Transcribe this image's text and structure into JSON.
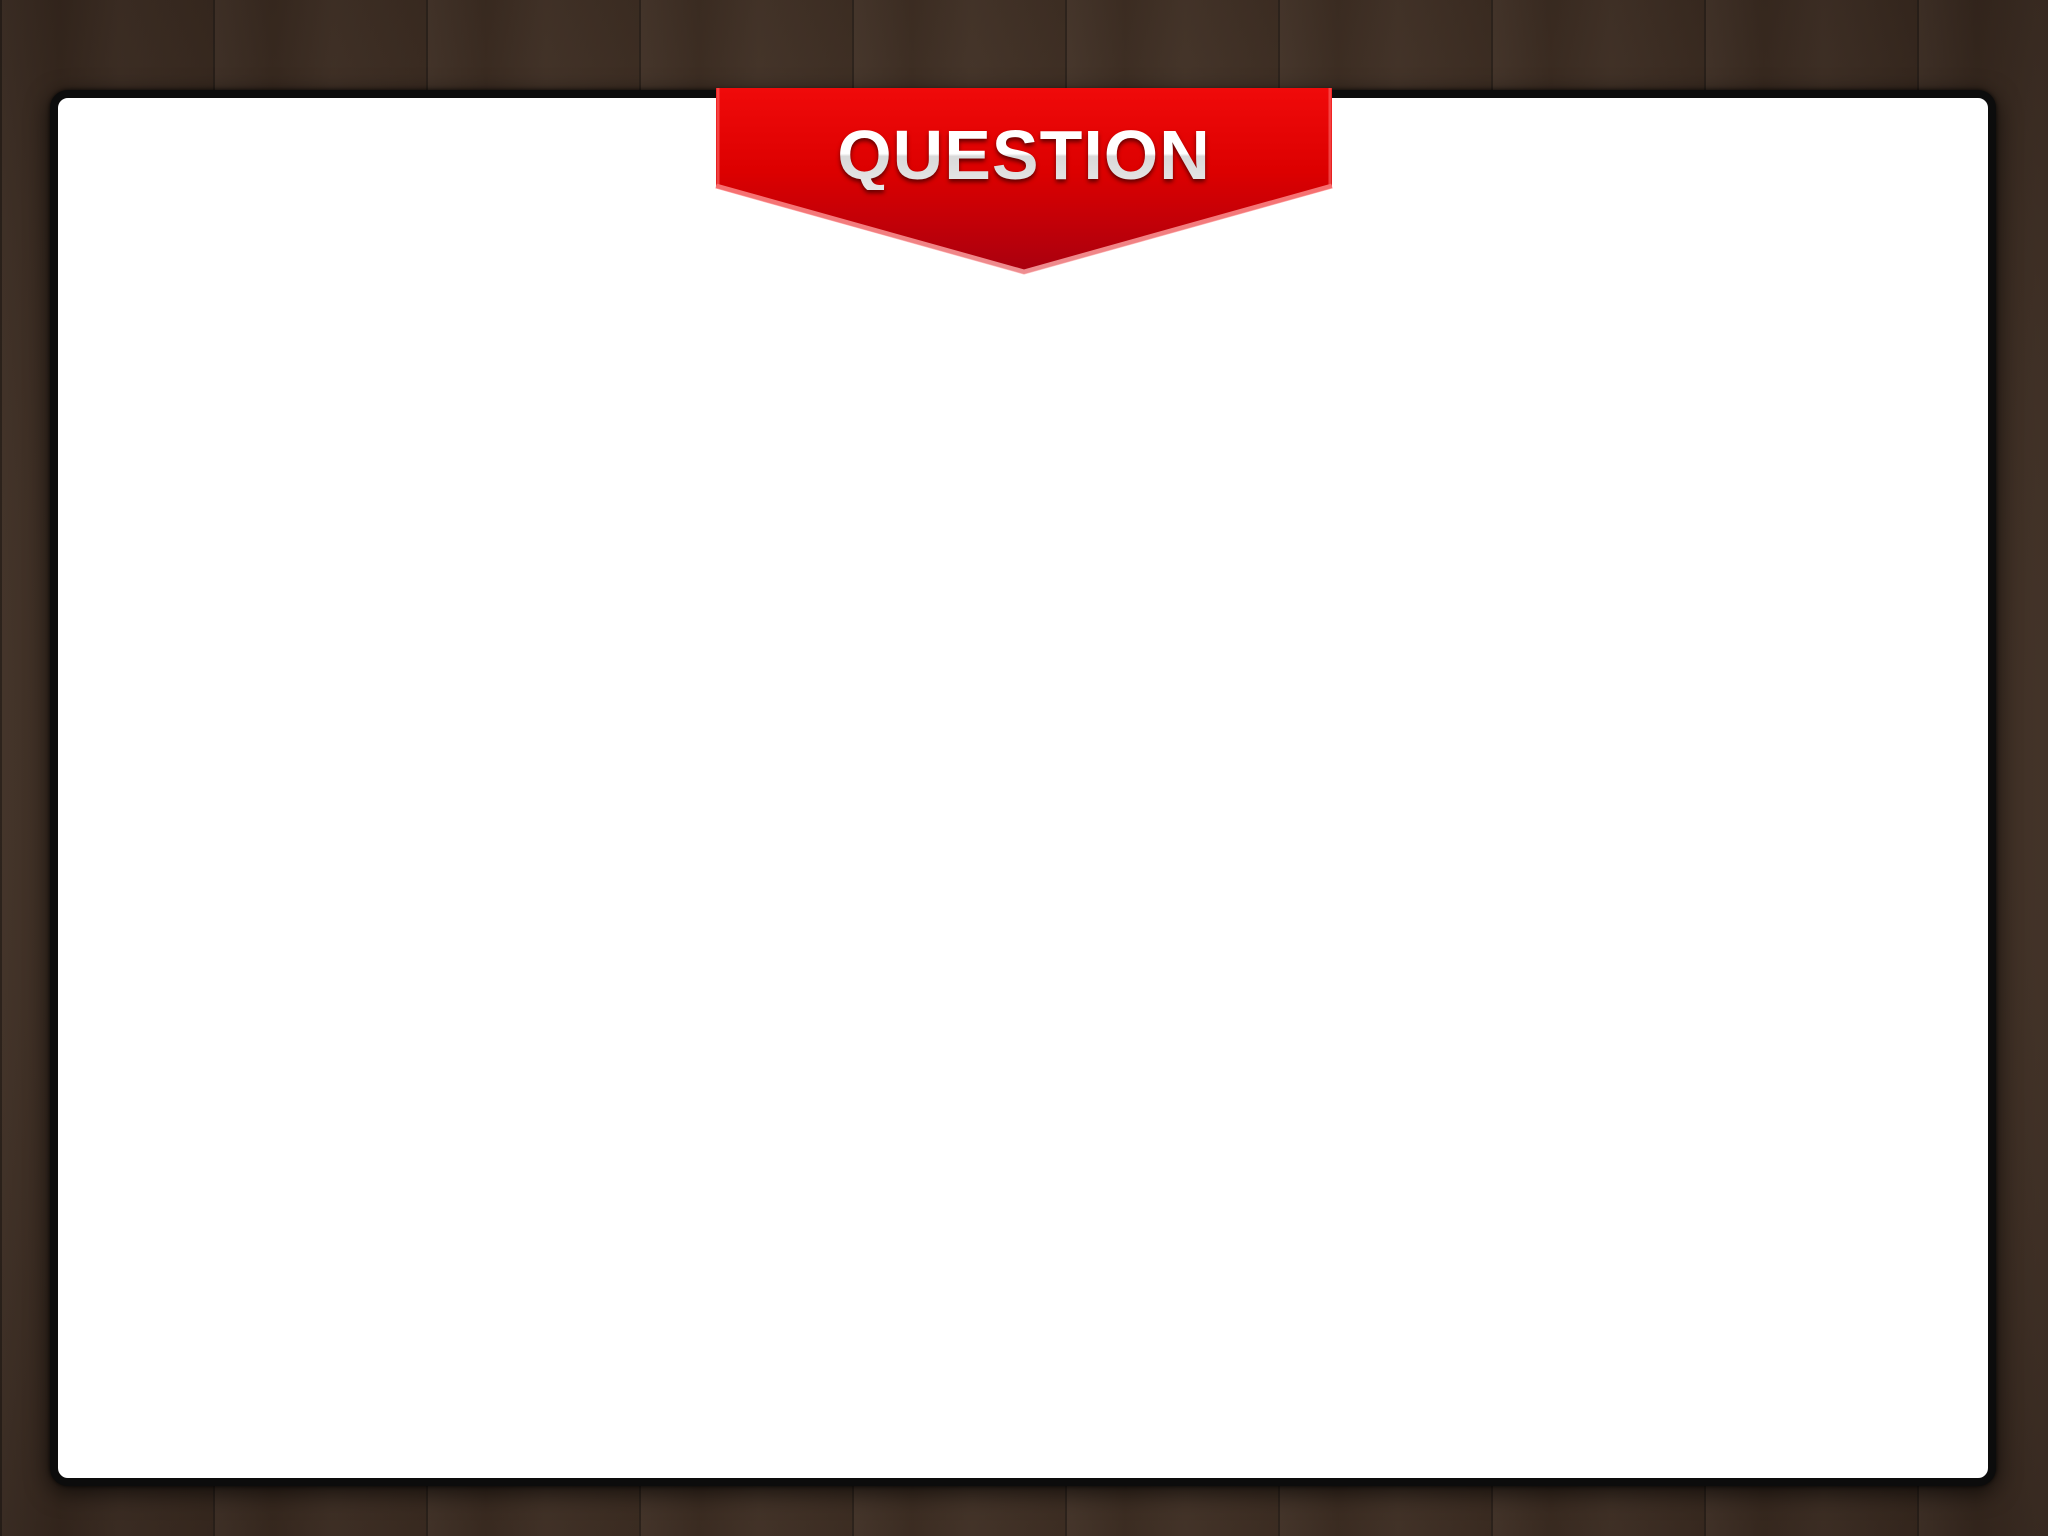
{
  "ribbon": {
    "label": "QUESTION",
    "color": "#e00000"
  },
  "board": {
    "background": "#ffffff",
    "border_color": "#0c0c0c"
  },
  "background": {
    "texture": "dark-wood-planks",
    "color": "#4a3a2e"
  }
}
